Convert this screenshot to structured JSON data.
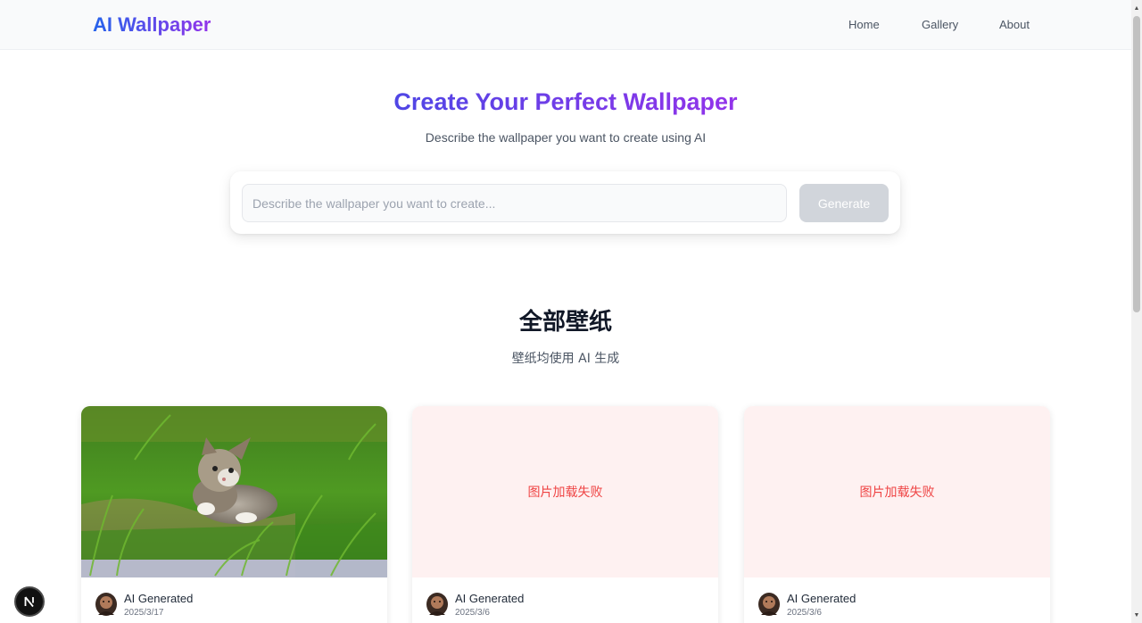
{
  "header": {
    "logo": "AI Wallpaper",
    "nav": [
      "Home",
      "Gallery",
      "About"
    ]
  },
  "hero": {
    "title": "Create Your Perfect Wallpaper",
    "subtitle": "Describe the wallpaper you want to create using AI",
    "input_placeholder": "Describe the wallpaper you want to create...",
    "input_value": "",
    "generate_label": "Generate"
  },
  "gallery": {
    "title": "全部壁纸",
    "subtitle": "壁纸均使用 AI 生成",
    "cards": [
      {
        "status": "loaded",
        "error_text": "",
        "author": "AI Generated",
        "date": "2025/3/17"
      },
      {
        "status": "error",
        "error_text": "图片加载失败",
        "author": "AI Generated",
        "date": "2025/3/6"
      },
      {
        "status": "error",
        "error_text": "图片加载失败",
        "author": "AI Generated",
        "date": "2025/3/6"
      }
    ]
  },
  "icons": {
    "dev_badge": "next-js-icon",
    "avatar": "avatar-icon"
  },
  "colors": {
    "brand_gradient_start": "#2563eb",
    "brand_gradient_end": "#9333ea",
    "error_text": "#ef4444",
    "error_bg": "#fef1f1",
    "button_disabled": "#d1d5db"
  }
}
